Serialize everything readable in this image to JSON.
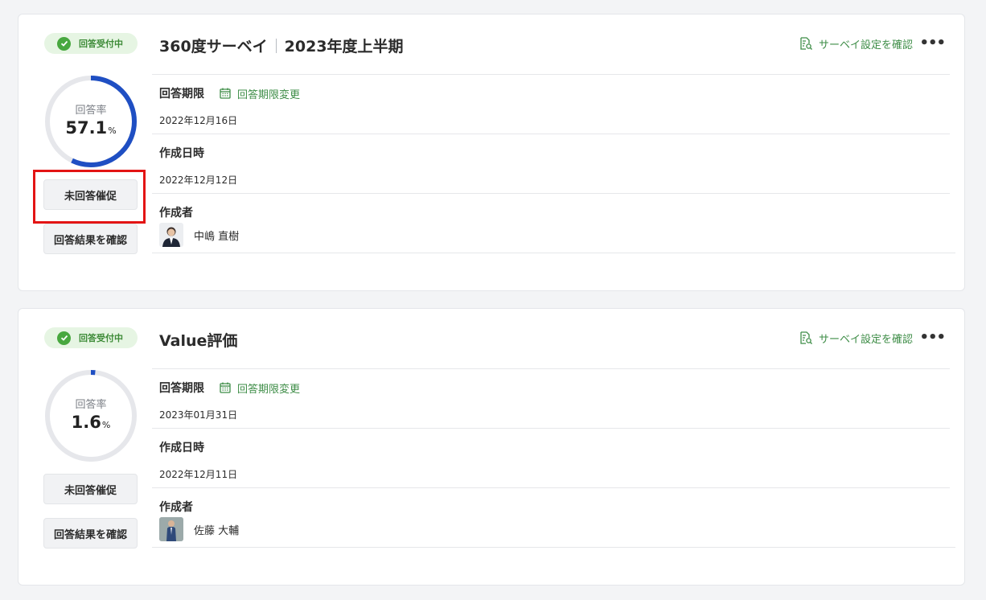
{
  "cards": [
    {
      "status": "回答受付中",
      "response_rate_label": "回答率",
      "response_rate_value": "57.1",
      "response_rate_unit": "%",
      "progress": 0.571,
      "remind_button": "未回答催促",
      "results_button": "回答結果を確認",
      "title": "360度サーベイ",
      "title_suffix": "2023年度上半期",
      "settings_link": "サーベイ設定を確認",
      "more": "•••",
      "deadline_label": "回答期限",
      "deadline_change": "回答期限変更",
      "deadline": "2022年12月16日",
      "created_label": "作成日時",
      "created": "2022年12月12日",
      "author_label": "作成者",
      "author": "中嶋 直樹"
    },
    {
      "status": "回答受付中",
      "response_rate_label": "回答率",
      "response_rate_value": "1.6",
      "response_rate_unit": "%",
      "progress": 0.016,
      "remind_button": "未回答催促",
      "results_button": "回答結果を確認",
      "title": "Value評価",
      "title_suffix": "",
      "settings_link": "サーベイ設定を確認",
      "more": "•••",
      "deadline_label": "回答期限",
      "deadline_change": "回答期限変更",
      "deadline": "2023年01月31日",
      "created_label": "作成日時",
      "created": "2022年12月11日",
      "author_label": "作成者",
      "author": "佐藤 大輔"
    }
  ],
  "colors": {
    "accent_green": "#3e8d47",
    "status_bg": "#e6f5e3",
    "progress_blue": "#1f4fc3",
    "progress_track": "#e6e7eb",
    "highlight_red": "#e31414"
  }
}
